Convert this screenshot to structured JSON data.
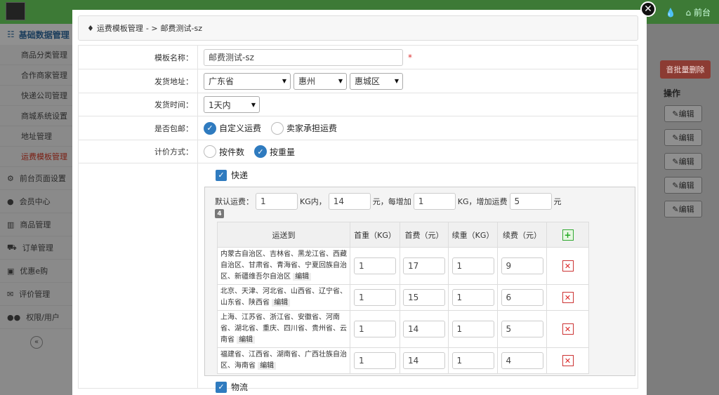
{
  "background": {
    "topbar": {
      "right_label": "前台"
    },
    "sidebar": {
      "section_title": "基础数据管理",
      "sub_items": [
        "商品分类管理",
        "合作商家管理",
        "快递公司管理",
        "商城系统设置",
        "地址管理",
        "运费模板管理"
      ],
      "menu_items": [
        "前台页面设置",
        "会员中心",
        "商品管理",
        "订单管理",
        "优惠e购",
        "评价管理",
        "权限/用户"
      ]
    },
    "bulk_delete_label": "音批量删除",
    "op_header": "操作",
    "edit_label": "编辑"
  },
  "breadcrumb": {
    "parent": "运费模板管理",
    "sep": "- >",
    "current": "邮费测试-sz"
  },
  "form": {
    "template_name_label": "模板名称：",
    "template_name_value": "邮费测试-sz",
    "ship_addr_label": "发货地址：",
    "province": "广东省",
    "city": "惠州",
    "district": "惠城区",
    "ship_time_label": "发货时间：",
    "ship_time": "1天内",
    "free_ship_label": "是否包邮：",
    "free_ship_options": [
      "自定义运费",
      "卖家承担运费"
    ],
    "pricing_label": "计价方式：",
    "pricing_options": [
      "按件数",
      "按重量"
    ]
  },
  "express": {
    "title": "快递",
    "default_label": "默认运费：",
    "default_weight": "1",
    "kg_within": "KG内，",
    "default_fee": "14",
    "yuan_each": "元，每增加",
    "add_weight": "1",
    "kg_add": "KG，增加运费",
    "add_fee": "5",
    "yuan": "元",
    "count": "4",
    "headers": [
      "运送到",
      "首重（KG）",
      "首费（元）",
      "续重（KG）",
      "续费（元）"
    ],
    "rules": [
      {
        "area": "内蒙古自治区、吉林省、黑龙江省、西藏自治区、甘肃省、青海省、宁夏回族自治区、新疆维吾尔自治区",
        "first_w": "1",
        "first_fee": "17",
        "next_w": "1",
        "next_fee": "9"
      },
      {
        "area": "北京、天津、河北省、山西省、辽宁省、山东省、陕西省",
        "first_w": "1",
        "first_fee": "15",
        "next_w": "1",
        "next_fee": "6"
      },
      {
        "area": "上海、江苏省、浙江省、安徽省、河南省、湖北省、重庆、四川省、贵州省、云南省",
        "first_w": "1",
        "first_fee": "14",
        "next_w": "1",
        "next_fee": "5"
      },
      {
        "area": "福建省、江西省、湖南省、广西壮族自治区、海南省",
        "first_w": "1",
        "first_fee": "14",
        "next_w": "1",
        "next_fee": "4"
      }
    ],
    "edit_link": "编辑"
  },
  "logistics": {
    "title": "物流"
  }
}
